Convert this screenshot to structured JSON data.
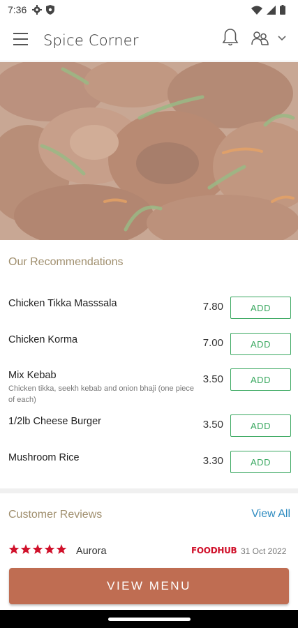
{
  "status_bar": {
    "time": "7:36",
    "left_icons": [
      "gear-icon",
      "shield-icon"
    ],
    "right_icons": [
      "wifi-icon",
      "signal-icon",
      "battery-icon"
    ]
  },
  "app_bar": {
    "title": "Spice Corner",
    "icons": [
      "menu-icon",
      "bell-icon",
      "people-icon",
      "chevron-down-icon"
    ]
  },
  "hero": {
    "description_icon": "food-photo"
  },
  "recommendations": {
    "title": "Our Recommendations",
    "items": [
      {
        "name": "Chicken Tikka Masssala",
        "description": "",
        "price": "7.80",
        "button": "ADD"
      },
      {
        "name": "Chicken Korma",
        "description": "",
        "price": "7.00",
        "button": "ADD"
      },
      {
        "name": "Mix Kebab",
        "description": "Chicken tikka, seekh kebab and onion bhaji (one piece of each)",
        "price": "3.50",
        "button": "ADD"
      },
      {
        "name": "1/2lb Cheese Burger",
        "description": "",
        "price": "3.50",
        "button": "ADD"
      },
      {
        "name": "Mushroom Rice",
        "description": "",
        "price": "3.30",
        "button": "ADD"
      }
    ]
  },
  "reviews": {
    "title": "Customer Reviews",
    "view_all": "View All",
    "items": [
      {
        "rating": 5,
        "reviewer": "Aurora",
        "source": "FOODHUB",
        "date": "31 Oct 2022"
      }
    ]
  },
  "cta": {
    "label": "VIEW MENU"
  },
  "colors": {
    "accent_gold": "#a08f6e",
    "add_green": "#3aa860",
    "cta": "#bf6d52",
    "link_blue": "#2e8bc0",
    "star_red": "#d0102a"
  }
}
